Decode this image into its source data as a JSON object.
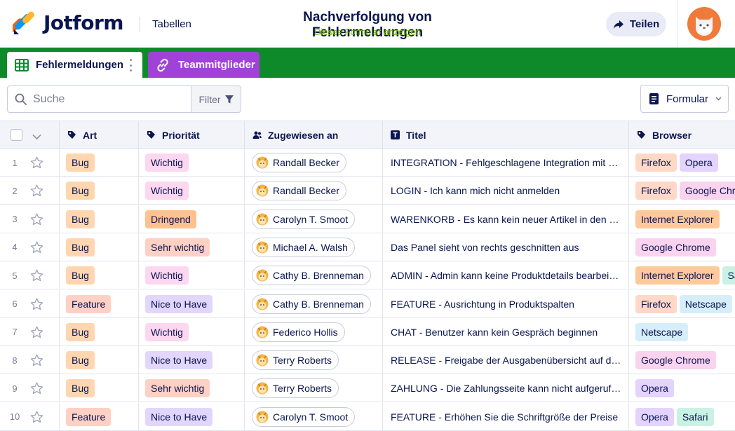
{
  "header": {
    "brand": "Jotform",
    "tables_link": "Tabellen",
    "form_title": "Nachverfolgung von Fehlermeldungen",
    "form_subtitle": "Dieses Formular anzeigen",
    "share_label": "Teilen"
  },
  "tabs": {
    "active_label": "Fehlermeldungen",
    "team_label": "Teammitglieder"
  },
  "toolbar": {
    "search_placeholder": "Suche",
    "filter_label": "Filter",
    "form_label": "Formular"
  },
  "columns": {
    "art": "Art",
    "prioritaet": "Priorität",
    "zugewiesen": "Zugewiesen an",
    "titel": "Titel",
    "browser": "Browser"
  },
  "colors": {
    "tabbar_green": "#0f8a2b",
    "team_tab_purple": "#a042d8",
    "subtitle_green": "#78bb07",
    "navy": "#0a1551"
  },
  "rows": [
    {
      "num": "1",
      "art": "Bug",
      "art_color": "p-orange",
      "prio": "Wichtig",
      "prio_color": "p-pink",
      "user": "Randall Becker",
      "title": "INTEGRATION - Fehlgeschlagene Integration mit externem Dienst",
      "browsers": [
        [
          "Firefox",
          "p-ff"
        ],
        [
          "Opera",
          "p-opera"
        ]
      ]
    },
    {
      "num": "2",
      "art": "Bug",
      "art_color": "p-orange",
      "prio": "Wichtig",
      "prio_color": "p-pink",
      "user": "Randall Becker",
      "title": "LOGIN - Ich kann mich nicht anmelden",
      "browsers": [
        [
          "Firefox",
          "p-ff"
        ],
        [
          "Google Chrome",
          "p-gc"
        ]
      ]
    },
    {
      "num": "3",
      "art": "Bug",
      "art_color": "p-orange",
      "prio": "Dringend",
      "prio_color": "p-orange2",
      "user": "Carolyn T. Smoot",
      "title": "WARENKORB - Es kann kein neuer Artikel in den Warenkorb gelegt werden",
      "browsers": [
        [
          "Internet Explorer",
          "p-ie"
        ]
      ]
    },
    {
      "num": "4",
      "art": "Bug",
      "art_color": "p-orange",
      "prio": "Sehr wichtig",
      "prio_color": "p-salmon",
      "user": "Michael A. Walsh",
      "title": "Das Panel sieht von rechts geschnitten aus",
      "browsers": [
        [
          "Google Chrome",
          "p-gc"
        ]
      ]
    },
    {
      "num": "5",
      "art": "Bug",
      "art_color": "p-orange",
      "prio": "Wichtig",
      "prio_color": "p-pink",
      "user": "Cathy B. Brenneman",
      "title": "ADMIN - Admin kann keine Produktdetails bearbeiten",
      "browsers": [
        [
          "Internet Explorer",
          "p-ie"
        ],
        [
          "Safari",
          "p-safari"
        ]
      ]
    },
    {
      "num": "6",
      "art": "Feature",
      "art_color": "p-salmon",
      "prio": "Nice to Have",
      "prio_color": "p-lilac",
      "user": "Cathy B. Brenneman",
      "title": "FEATURE - Ausrichtung in Produktspalten",
      "browsers": [
        [
          "Firefox",
          "p-ff"
        ],
        [
          "Netscape",
          "p-ns"
        ]
      ]
    },
    {
      "num": "7",
      "art": "Bug",
      "art_color": "p-orange",
      "prio": "Wichtig",
      "prio_color": "p-pink",
      "user": "Federico Hollis",
      "title": "CHAT - Benutzer kann kein Gespräch beginnen",
      "browsers": [
        [
          "Netscape",
          "p-ns"
        ]
      ]
    },
    {
      "num": "8",
      "art": "Bug",
      "art_color": "p-orange",
      "prio": "Nice to Have",
      "prio_color": "p-lilac",
      "user": "Terry Roberts",
      "title": "RELEASE - Freigabe der Ausgabenübersicht auf dem Dashboard",
      "browsers": [
        [
          "Google Chrome",
          "p-gc"
        ]
      ]
    },
    {
      "num": "9",
      "art": "Bug",
      "art_color": "p-orange",
      "prio": "Sehr wichtig",
      "prio_color": "p-salmon",
      "user": "Terry Roberts",
      "title": "ZAHLUNG - Die Zahlungsseite kann nicht aufgerufen werden",
      "browsers": [
        [
          "Opera",
          "p-opera"
        ]
      ]
    },
    {
      "num": "10",
      "art": "Feature",
      "art_color": "p-salmon",
      "prio": "Nice to Have",
      "prio_color": "p-lilac",
      "user": "Carolyn T. Smoot",
      "title": "FEATURE - Erhöhen Sie die Schriftgröße der Preise",
      "browsers": [
        [
          "Opera",
          "p-opera"
        ],
        [
          "Safari",
          "p-safari"
        ]
      ]
    }
  ]
}
